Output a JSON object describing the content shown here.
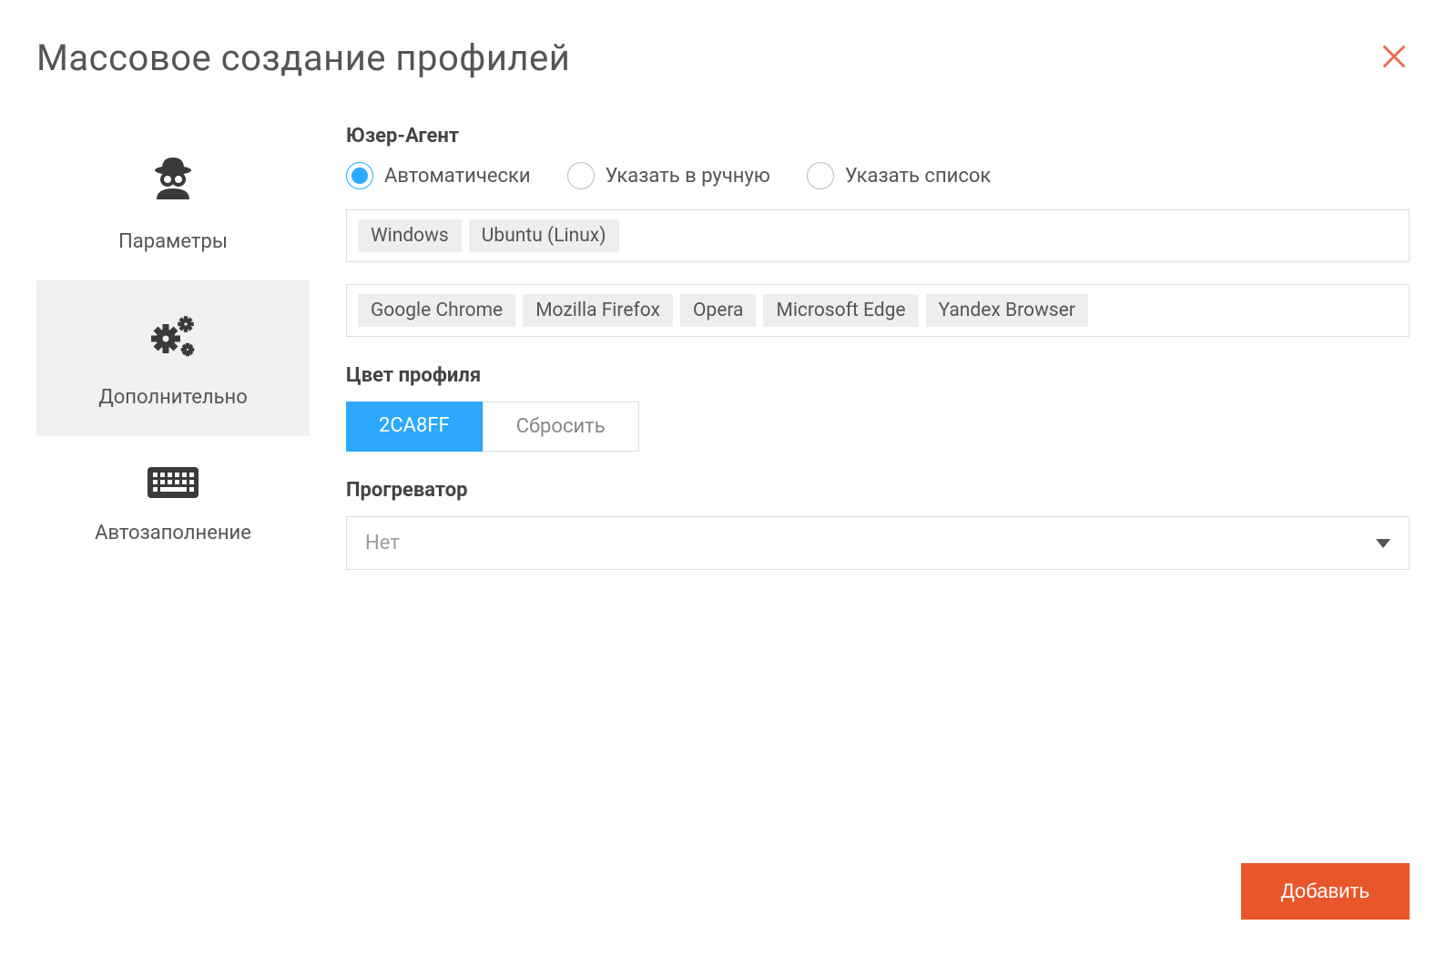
{
  "header": {
    "title": "Массовое создание профилей"
  },
  "sidebar": {
    "items": [
      {
        "label": "Параметры"
      },
      {
        "label": "Дополнительно"
      },
      {
        "label": "Автозаполнение"
      }
    ]
  },
  "user_agent": {
    "title": "Юзер-Агент",
    "options": [
      {
        "label": "Автоматически",
        "selected": true
      },
      {
        "label": "Указать в ручную",
        "selected": false
      },
      {
        "label": "Указать список",
        "selected": false
      }
    ],
    "os_tags": [
      "Windows",
      "Ubuntu (Linux)"
    ],
    "browser_tags": [
      "Google Chrome",
      "Mozilla Firefox",
      "Opera",
      "Microsoft Edge",
      "Yandex Browser"
    ]
  },
  "profile_color": {
    "title": "Цвет профиля",
    "value": "2CA8FF",
    "reset_label": "Сбросить",
    "color_hex": "#2ca8ff"
  },
  "warmer": {
    "title": "Прогреватор",
    "selected": "Нет"
  },
  "footer": {
    "add_label": "Добавить"
  },
  "colors": {
    "accent_blue": "#2ca8ff",
    "accent_orange": "#e8572c",
    "close_icon": "#ec6a4c"
  }
}
